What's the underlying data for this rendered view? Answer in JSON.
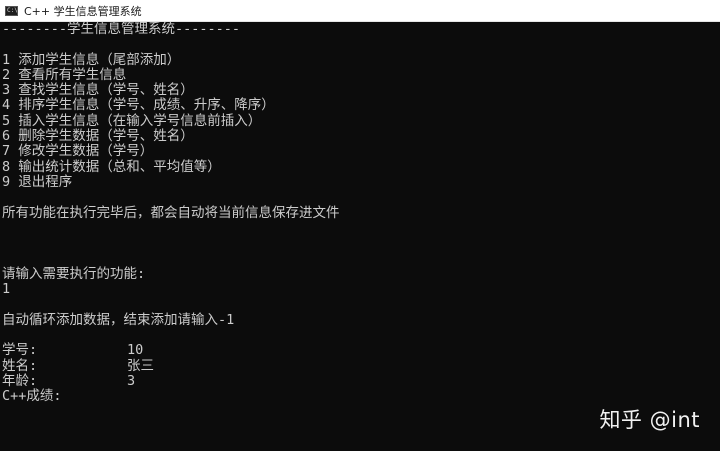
{
  "window": {
    "title": "C++ 学生信息管理系统",
    "icon": "console-app-icon",
    "icon_glyph": "C:\\"
  },
  "console": {
    "header": "--------学生信息管理系统--------",
    "menu": [
      "1 添加学生信息（尾部添加）",
      "2 查看所有学生信息",
      "3 查找学生信息（学号、姓名）",
      "4 排序学生信息（学号、成绩、升序、降序）",
      "5 插入学生信息（在输入学号信息前插入）",
      "6 删除学生数据（学号、姓名）",
      "7 修改学生数据（学号）",
      "8 输出统计数据（总和、平均值等）",
      "9 退出程序"
    ],
    "notice": "所有功能在执行完毕后，都会自动将当前信息保存进文件",
    "prompt": "请输入需要执行的功能:",
    "input": "1",
    "auto_msg": "自动循环添加数据，结束添加请输入-1",
    "fields": [
      {
        "label": "学号:",
        "value": "10"
      },
      {
        "label": "姓名:",
        "value": "张三"
      },
      {
        "label": "年龄:",
        "value": "3"
      },
      {
        "label": "C++成绩:",
        "value": ""
      }
    ]
  },
  "watermark": "知乎 @int",
  "colors": {
    "background": "#0c0c0c",
    "text": "#cccccc",
    "titlebar": "#ffffff"
  }
}
